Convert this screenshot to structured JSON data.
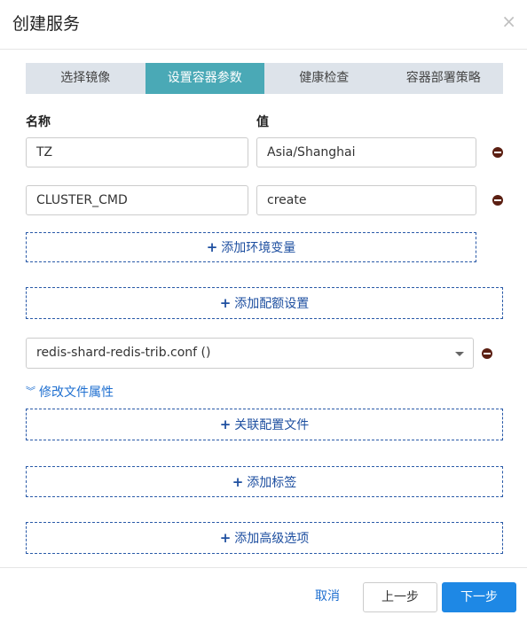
{
  "dialog": {
    "title": "创建服务",
    "close_icon": "×"
  },
  "tabs": [
    {
      "label": "选择镜像",
      "active": false
    },
    {
      "label": "设置容器参数",
      "active": true
    },
    {
      "label": "健康检查",
      "active": false
    },
    {
      "label": "容器部署策略",
      "active": false
    }
  ],
  "env": {
    "name_header": "名称",
    "value_header": "值",
    "rows": [
      {
        "name": "TZ",
        "value": "Asia/Shanghai"
      },
      {
        "name": "CLUSTER_CMD",
        "value": "create"
      }
    ],
    "add_label": "添加环境变量"
  },
  "quota": {
    "add_label": "添加配额设置"
  },
  "config": {
    "selected": "redis-shard-redis-trib.conf ()",
    "modify_label": "修改文件属性",
    "modify_icon": "»",
    "link_label": "关联配置文件"
  },
  "labels": {
    "add_label": "添加标签"
  },
  "advanced": {
    "add_label": "添加高级选项"
  },
  "footer": {
    "cancel": "取消",
    "prev": "上一步",
    "next": "下一步"
  },
  "colors": {
    "tab_active": "#4aa9b6",
    "tab_bg": "#dde3ea",
    "link_blue": "#1e6fd0",
    "primary": "#1e88e5",
    "remove_icon": "#5b1f12"
  }
}
